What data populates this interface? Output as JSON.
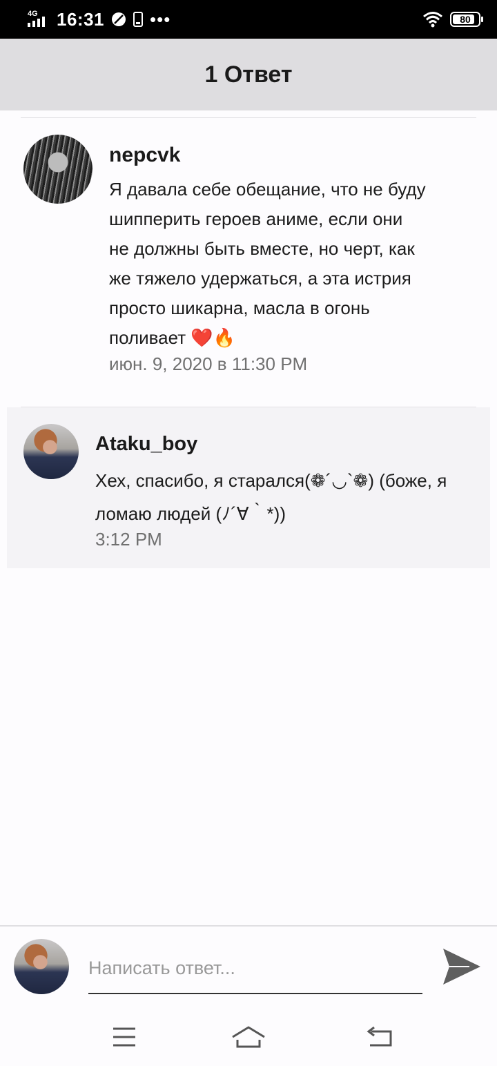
{
  "status_bar": {
    "network": "4G",
    "time": "16:31",
    "dots": "•••",
    "battery": "80"
  },
  "header": {
    "title": "1 Ответ"
  },
  "comment": {
    "username": "nepcvk",
    "text": "Я давала себе обещание, что не буду шипперить героев аниме, если они не должны быть вместе, но черт, как же тяжело удержаться, а эта истрия просто шикарна, масла в огонь поливает ❤️🔥",
    "lines": [
      "Я давала себе обещание, что не буду",
      "шипперить героев аниме, если они",
      "не должны быть вместе, но черт, как",
      "же тяжело удержаться, а эта истрия",
      "просто шикарна, масла в огонь",
      "поливает ❤️🔥"
    ],
    "timestamp": "июн. 9, 2020 в 11:30 PM"
  },
  "reply": {
    "username": "Ataku_boy",
    "lines": [
      "Хех, спасибо, я старался(❁´◡`❁) (боже, я",
      "ломаю людей (ﾉ´∀｀*))"
    ],
    "timestamp": "3:12 PM"
  },
  "composer": {
    "placeholder": "Написать ответ...",
    "value": ""
  },
  "nav": {
    "items": [
      "menu-icon",
      "home-icon",
      "back-icon"
    ]
  },
  "colors": {
    "header_bg": "#dedde0",
    "reply_bg": "#f4f3f6",
    "timestamp": "#707070",
    "send_icon": "#5f5f5f"
  }
}
